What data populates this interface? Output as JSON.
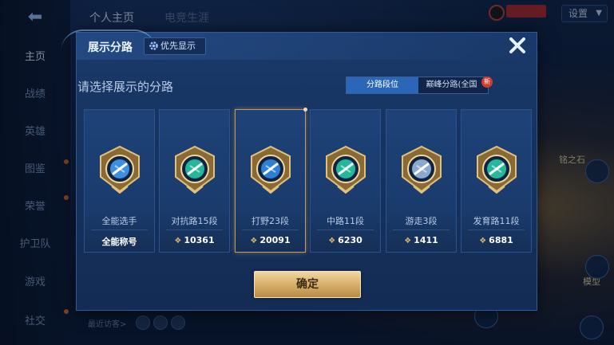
{
  "background": {
    "top_tabs": [
      "个人主页",
      "电竞生涯"
    ],
    "settings_label": "设置",
    "sidebar_items": [
      "主页",
      "战绩",
      "英雄",
      "图鉴",
      "荣誉",
      "护卫队",
      "游戏",
      "社交"
    ],
    "recent_visitors": "最近访客>",
    "right_labels": [
      "铭之石",
      "模型"
    ]
  },
  "modal": {
    "title": "展示分路",
    "priority_label": "优先显示",
    "close_icon": "close-x-icon",
    "subtitle": "请选择展示的分路",
    "toggle": {
      "active": "分路段位",
      "inactive": "巅峰分路(全国",
      "new_badge": "新"
    },
    "lanes": [
      {
        "label": "全能选手",
        "score": "全能称号",
        "emblem": "allround-emblem-icon",
        "has_wing": false,
        "accent": "#3f8fe0"
      },
      {
        "label": "对抗路15段",
        "score": "10361",
        "emblem": "clash-lane-emblem-icon",
        "has_wing": true,
        "accent": "#24b79a"
      },
      {
        "label": "打野23段",
        "score": "20091",
        "emblem": "jungle-emblem-icon",
        "has_wing": true,
        "accent": "#2f7fd6"
      },
      {
        "label": "中路11段",
        "score": "6230",
        "emblem": "mid-lane-emblem-icon",
        "has_wing": true,
        "accent": "#24b79a"
      },
      {
        "label": "游走3段",
        "score": "1411",
        "emblem": "roam-emblem-icon",
        "has_wing": true,
        "accent": "#8aa9cc"
      },
      {
        "label": "发育路11段",
        "score": "6881",
        "emblem": "farm-lane-emblem-icon",
        "has_wing": true,
        "accent": "#24b79a"
      }
    ],
    "selected_index": 2,
    "confirm_label": "确定"
  },
  "colors": {
    "gold": "#d9b56a",
    "selected_border": "#c89a5c",
    "toggle_active": "#2b67b8"
  }
}
